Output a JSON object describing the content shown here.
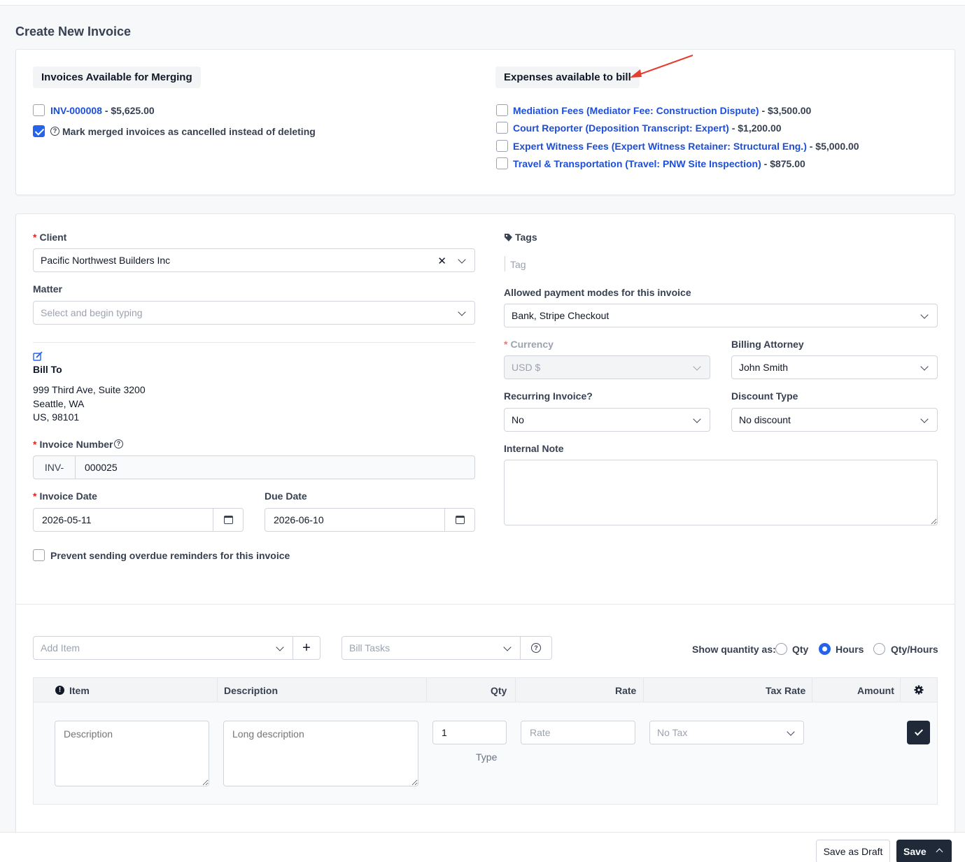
{
  "page": {
    "title": "Create New Invoice"
  },
  "merge": {
    "heading": "Invoices Available for Merging",
    "invoice_link": "INV-000008",
    "invoice_amount": " - $5,625.00",
    "mark_cancelled_label": "Mark merged invoices as cancelled instead of deleting"
  },
  "expenses": {
    "heading": "Expenses available to bill",
    "items": [
      {
        "label": "Mediation Fees (Mediator Fee: Construction Dispute)",
        "amount": " - $3,500.00"
      },
      {
        "label": "Court Reporter (Deposition Transcript: Expert)",
        "amount": " - $1,200.00"
      },
      {
        "label": "Expert Witness Fees (Expert Witness Retainer: Structural Eng.)",
        "amount": " - $5,000.00"
      },
      {
        "label": "Travel & Transportation (Travel: PNW Site Inspection)",
        "amount": " - $875.00"
      }
    ]
  },
  "form": {
    "client_label": "Client",
    "client_value": "Pacific Northwest Builders Inc",
    "matter_label": "Matter",
    "matter_placeholder": "Select and begin typing",
    "bill_to_label": "Bill To",
    "address_line1": "999 Third Ave, Suite 3200",
    "address_line2": "Seattle, WA",
    "address_line3": "US, 98101",
    "invoice_number_label": "Invoice Number",
    "invoice_prefix": "INV-",
    "invoice_number": "000025",
    "invoice_date_label": "Invoice Date",
    "invoice_date": "2026-05-11",
    "due_date_label": "Due Date",
    "due_date": "2026-06-10",
    "prevent_reminders_label": "Prevent sending overdue reminders for this invoice",
    "tags_label": "Tags",
    "tag_placeholder": "Tag",
    "payment_modes_label": "Allowed payment modes for this invoice",
    "payment_modes_value": "Bank, Stripe Checkout",
    "currency_label": "Currency",
    "currency_value": "USD $",
    "billing_attorney_label": "Billing Attorney",
    "billing_attorney_value": "John Smith",
    "recurring_label": "Recurring Invoice?",
    "recurring_value": "No",
    "discount_type_label": "Discount Type",
    "discount_type_value": "No discount",
    "internal_note_label": "Internal Note"
  },
  "items": {
    "add_item_placeholder": "Add Item",
    "bill_tasks_placeholder": "Bill Tasks",
    "show_quantity_label": "Show quantity as:",
    "qty_option": "Qty",
    "hours_option": "Hours",
    "qty_hours_option": "Qty/Hours",
    "columns": {
      "item": "Item",
      "description": "Description",
      "qty": "Qty",
      "rate": "Rate",
      "tax_rate": "Tax Rate",
      "amount": "Amount"
    },
    "row": {
      "description_placeholder": "Description",
      "long_description_placeholder": "Long description",
      "qty_value": "1",
      "type_label": "Type",
      "rate_placeholder": "Rate",
      "tax_value": "No Tax"
    }
  },
  "footer": {
    "save_draft_label": "Save as Draft",
    "save_label": "Save"
  },
  "colors": {
    "accent": "#2563eb",
    "link": "#1d4ed8",
    "dark_button": "#1f2937",
    "annotation_arrow": "#e53e2e"
  }
}
